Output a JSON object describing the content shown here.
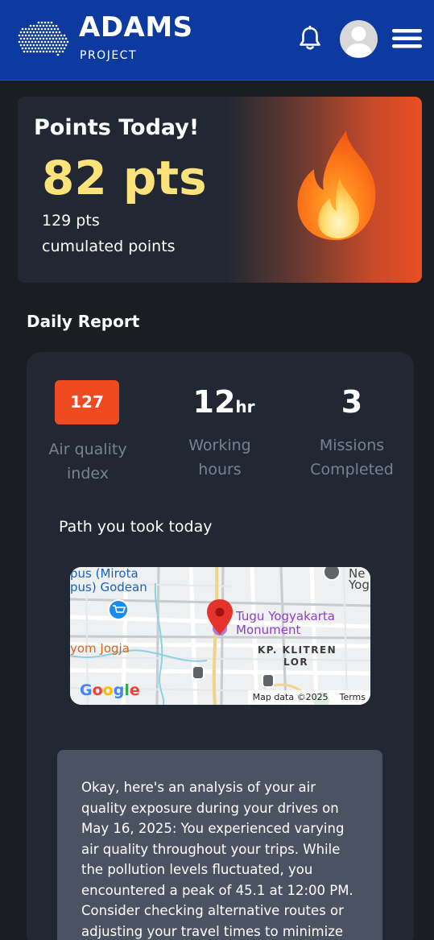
{
  "header": {
    "brand_title": "ADAMS",
    "brand_subtitle": "PROJECT",
    "icons": {
      "logo": "logo-dots-icon",
      "bell": "bell-icon",
      "avatar": "avatar-icon",
      "menu": "hamburger-menu-icon"
    }
  },
  "points_card": {
    "title": "Points Today!",
    "value": "82 pts",
    "cumulated_value": "129 pts",
    "cumulated_label": "cumulated points",
    "icon": "fire-icon"
  },
  "daily_report": {
    "title": "Daily Report",
    "air_quality": {
      "value": "127",
      "label_line1": "Air quality",
      "label_line2": "index"
    },
    "working_hours": {
      "value": "12",
      "unit": "hr",
      "label_line1": "Working",
      "label_line2": "hours"
    },
    "missions": {
      "value": "3",
      "label_line1": "Missions",
      "label_line2": "Completed"
    },
    "path_title": "Path you took today",
    "map": {
      "labels": {
        "place1_line1": "pus (Mirota",
        "place1_line2": "pus) Godean",
        "place2": "yom Jogja",
        "monument_line1": "Tugu Yogyakarta",
        "monument_line2": "Monument",
        "district_line1": "KP. KLITREN",
        "district_line2": "LOR",
        "corner_line1": "Ne",
        "corner_line2": "Yog"
      },
      "google_logo": "Google",
      "attribution": "Map data ©2025",
      "terms": "Terms"
    },
    "summary": "Okay, here's an analysis of your air quality exposure during your drives on May 16, 2025: You experienced varying air quality throughout your trips. While the pollution levels fluctuated, you encountered a peak of 45.1 at 12:00 PM. Consider checking alternative routes or adjusting your travel times to minimize exposure during peak"
  },
  "colors": {
    "header_bg": "#0d3a9e",
    "page_bg": "#1a1d22",
    "card_bg": "#222833",
    "points_value": "#fbe27a",
    "aqi_badge": "#f04a22",
    "summary_bg": "#4b5363"
  }
}
